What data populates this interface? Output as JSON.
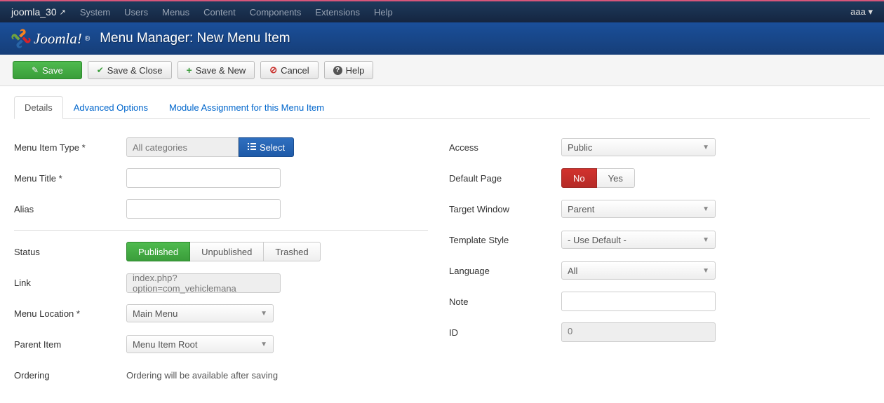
{
  "navbar": {
    "brand": "joomla_30",
    "menu": [
      "System",
      "Users",
      "Menus",
      "Content",
      "Components",
      "Extensions",
      "Help"
    ],
    "user": "aaa"
  },
  "header": {
    "logo_text": "Joomla!",
    "title": "Menu Manager: New Menu Item"
  },
  "toolbar": {
    "save": "Save",
    "save_close": "Save & Close",
    "save_new": "Save & New",
    "cancel": "Cancel",
    "help": "Help"
  },
  "tabs": {
    "details": "Details",
    "advanced": "Advanced Options",
    "module": "Module Assignment for this Menu Item"
  },
  "left": {
    "menu_item_type": {
      "label": "Menu Item Type *",
      "value": "All categories",
      "select_btn": "Select"
    },
    "menu_title": {
      "label": "Menu Title *",
      "value": ""
    },
    "alias": {
      "label": "Alias",
      "value": ""
    },
    "status": {
      "label": "Status",
      "published": "Published",
      "unpublished": "Unpublished",
      "trashed": "Trashed"
    },
    "link": {
      "label": "Link",
      "value": "index.php?option=com_vehiclemana"
    },
    "menu_location": {
      "label": "Menu Location *",
      "value": "Main Menu"
    },
    "parent_item": {
      "label": "Parent Item",
      "value": "Menu Item Root"
    },
    "ordering": {
      "label": "Ordering",
      "value": "Ordering will be available after saving"
    }
  },
  "right": {
    "access": {
      "label": "Access",
      "value": "Public"
    },
    "default_page": {
      "label": "Default Page",
      "no": "No",
      "yes": "Yes"
    },
    "target_window": {
      "label": "Target Window",
      "value": "Parent"
    },
    "template_style": {
      "label": "Template Style",
      "value": "- Use Default -"
    },
    "language": {
      "label": "Language",
      "value": "All"
    },
    "note": {
      "label": "Note",
      "value": ""
    },
    "id": {
      "label": "ID",
      "value": "0"
    }
  }
}
